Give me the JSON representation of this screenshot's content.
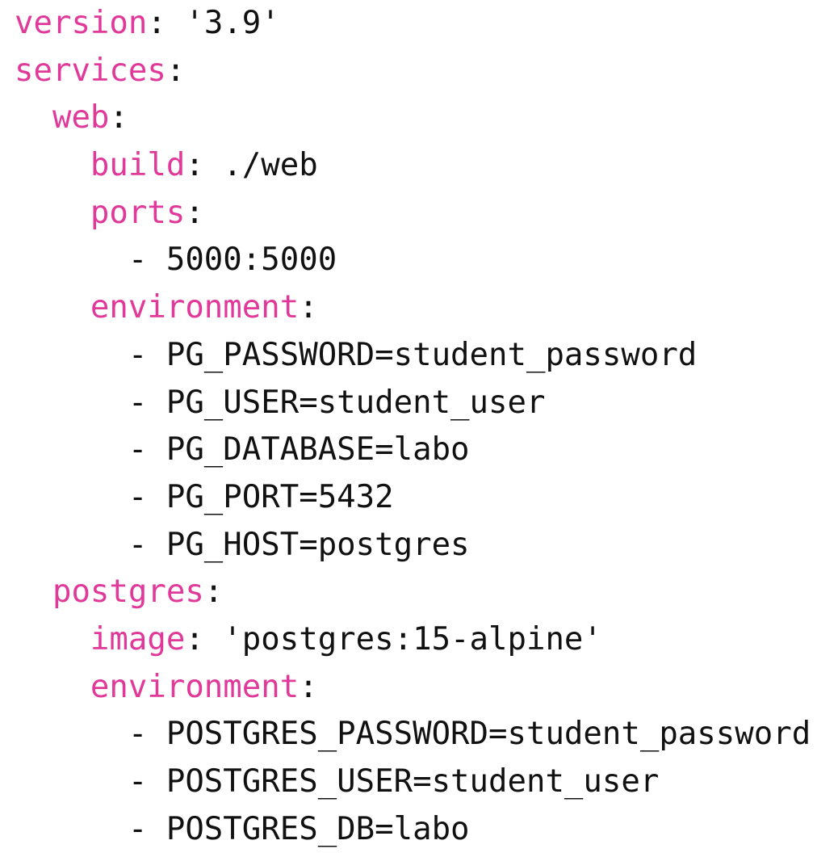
{
  "colors": {
    "key": "#e0399a",
    "text": "#111111",
    "background": "#ffffff"
  },
  "lines": [
    {
      "indent": "",
      "key": "version",
      "sep": ": ",
      "value": "'3.9'"
    },
    {
      "indent": "",
      "key": "services",
      "sep": ":",
      "value": ""
    },
    {
      "indent": "  ",
      "key": "web",
      "sep": ":",
      "value": ""
    },
    {
      "indent": "    ",
      "key": "build",
      "sep": ": ",
      "value": "./web"
    },
    {
      "indent": "    ",
      "key": "ports",
      "sep": ":",
      "value": ""
    },
    {
      "indent": "      ",
      "key": "",
      "sep": "",
      "value": "- 5000:5000"
    },
    {
      "indent": "    ",
      "key": "environment",
      "sep": ":",
      "value": ""
    },
    {
      "indent": "      ",
      "key": "",
      "sep": "",
      "value": "- PG_PASSWORD=student_password"
    },
    {
      "indent": "      ",
      "key": "",
      "sep": "",
      "value": "- PG_USER=student_user"
    },
    {
      "indent": "      ",
      "key": "",
      "sep": "",
      "value": "- PG_DATABASE=labo"
    },
    {
      "indent": "      ",
      "key": "",
      "sep": "",
      "value": "- PG_PORT=5432"
    },
    {
      "indent": "      ",
      "key": "",
      "sep": "",
      "value": "- PG_HOST=postgres"
    },
    {
      "indent": "  ",
      "key": "postgres",
      "sep": ":",
      "value": ""
    },
    {
      "indent": "    ",
      "key": "image",
      "sep": ": ",
      "value": "'postgres:15-alpine'"
    },
    {
      "indent": "    ",
      "key": "environment",
      "sep": ":",
      "value": ""
    },
    {
      "indent": "      ",
      "key": "",
      "sep": "",
      "value": "- POSTGRES_PASSWORD=student_password"
    },
    {
      "indent": "      ",
      "key": "",
      "sep": "",
      "value": "- POSTGRES_USER=student_user"
    },
    {
      "indent": "      ",
      "key": "",
      "sep": "",
      "value": "- POSTGRES_DB=labo"
    }
  ]
}
